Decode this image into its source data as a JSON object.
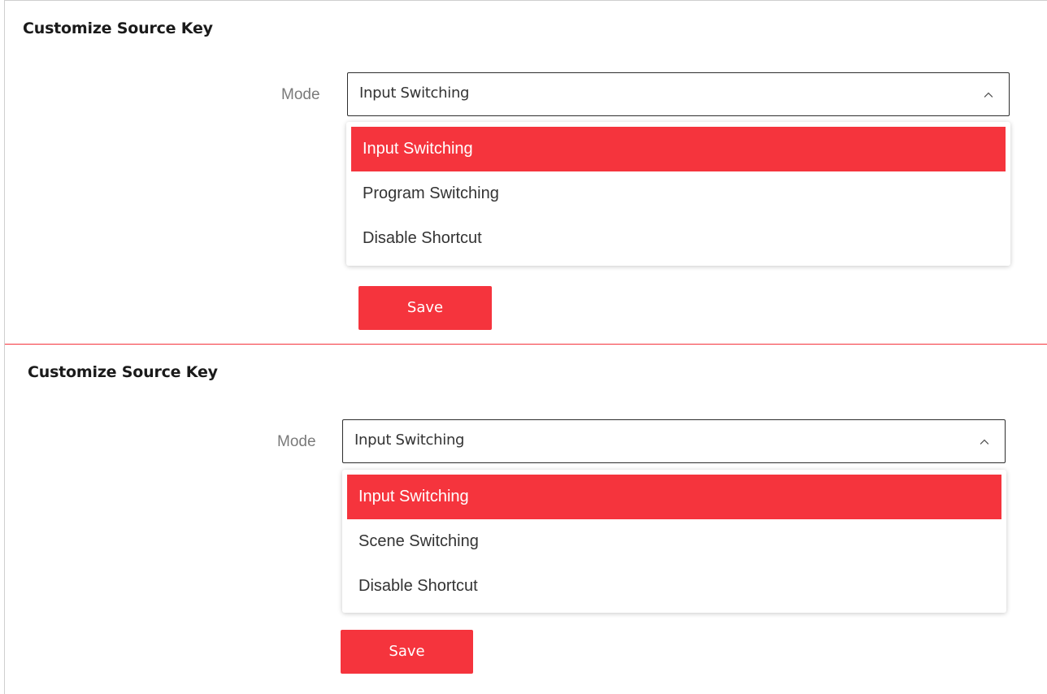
{
  "accent_color": "#f5343d",
  "panels": [
    {
      "title": "Customize Source Key",
      "mode_label": "Mode",
      "select_value": "Input Switching",
      "options": [
        "Input Switching",
        "Program Switching",
        "Disable Shortcut"
      ],
      "selected_index": 0,
      "save_label": "Save",
      "chevron_icon": "chevron-up-icon"
    },
    {
      "title": "Customize Source Key",
      "mode_label": "Mode",
      "select_value": "Input Switching",
      "options": [
        "Input Switching",
        "Scene Switching",
        "Disable Shortcut"
      ],
      "selected_index": 0,
      "save_label": "Save",
      "chevron_icon": "chevron-up-icon"
    }
  ]
}
